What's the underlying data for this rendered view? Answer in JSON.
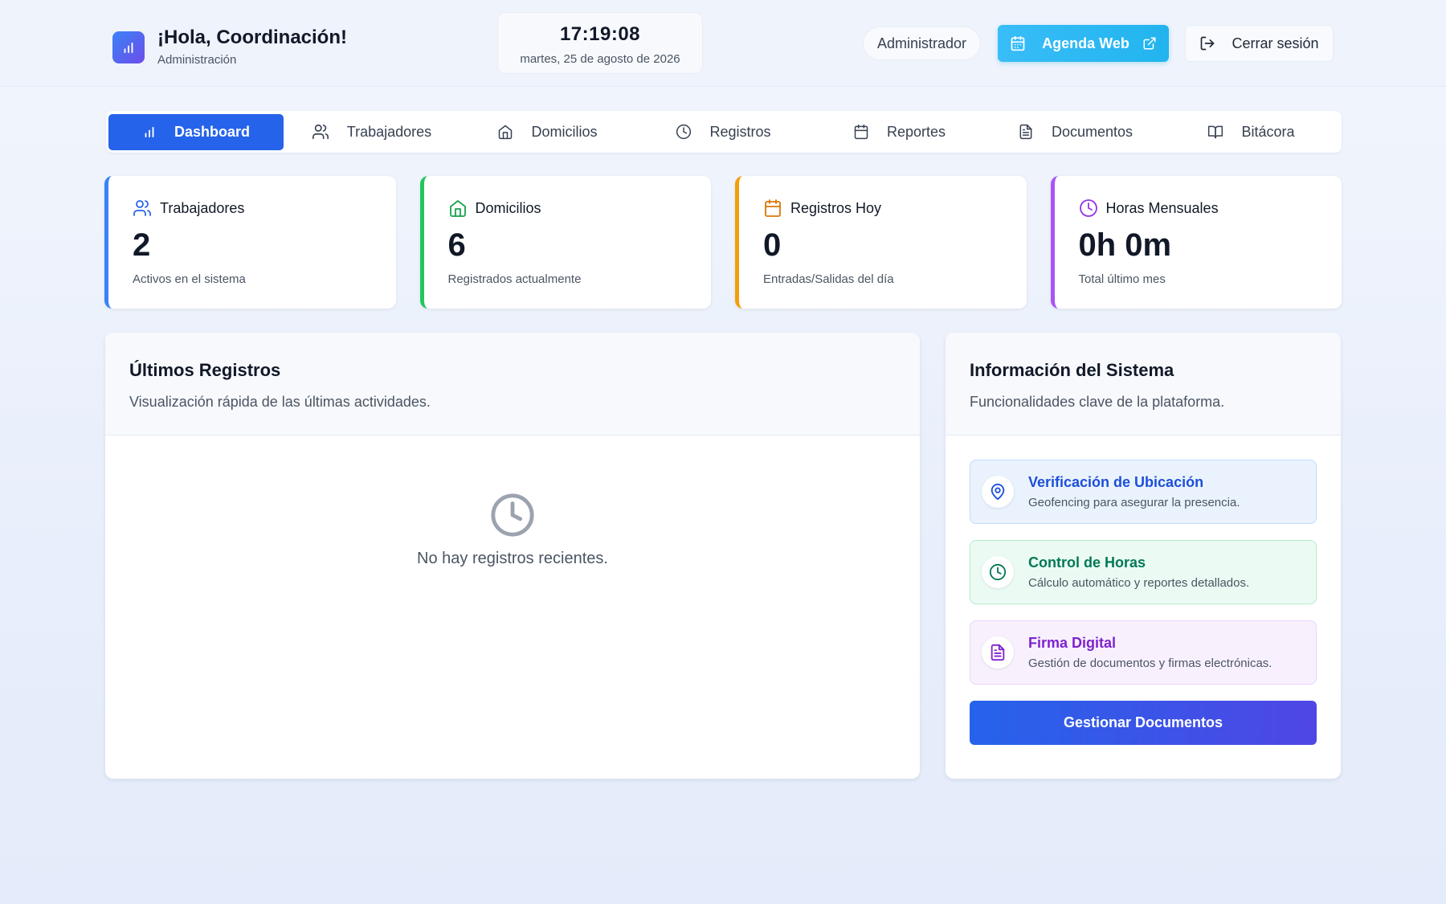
{
  "header": {
    "greeting": "¡Hola, Coordinación!",
    "role": "Administración",
    "clock_time": "17:19:08",
    "clock_date": "martes, 25 de agosto de 2026",
    "user_role_chip": "Administrador",
    "agenda_label": "Agenda Web",
    "logout_label": "Cerrar sesión",
    "icons": {
      "logo": "bar-chart-icon",
      "agenda": "calendar-icon",
      "agenda_external": "external-link-icon",
      "logout": "log-out-icon"
    }
  },
  "tabs": [
    {
      "label": "Dashboard",
      "icon": "bar-chart-icon",
      "active": true
    },
    {
      "label": "Trabajadores",
      "icon": "users-icon"
    },
    {
      "label": "Domicilios",
      "icon": "home-icon"
    },
    {
      "label": "Registros",
      "icon": "clock-icon"
    },
    {
      "label": "Reportes",
      "icon": "calendar-icon"
    },
    {
      "label": "Documentos",
      "icon": "file-text-icon"
    },
    {
      "label": "Bitácora",
      "icon": "book-open-icon"
    }
  ],
  "stats": [
    {
      "title": "Trabajadores",
      "value": "2",
      "subtitle": "Activos en el sistema",
      "color": "#3b82f6",
      "icon": "users-icon"
    },
    {
      "title": "Domicilios",
      "value": "6",
      "subtitle": "Registrados actualmente",
      "color": "#22c55e",
      "icon": "home-icon"
    },
    {
      "title": "Registros Hoy",
      "value": "0",
      "subtitle": "Entradas/Salidas del día",
      "color": "#f59e0b",
      "icon": "calendar-icon"
    },
    {
      "title": "Horas Mensuales",
      "value": "0h 0m",
      "subtitle": "Total último mes",
      "color": "#a855f7",
      "icon": "clock-icon"
    }
  ],
  "recent": {
    "title": "Últimos Registros",
    "description": "Visualización rápida de las últimas actividades.",
    "empty_text": "No hay registros recientes.",
    "empty_icon": "clock-icon"
  },
  "system": {
    "title": "Información del Sistema",
    "description": "Funcionalidades clave de la plataforma.",
    "features": [
      {
        "title": "Verificación de Ubicación",
        "description": "Geofencing para asegurar la presencia.",
        "icon": "map-pin-icon",
        "color": "#1d4ed8"
      },
      {
        "title": "Control de Horas",
        "description": "Cálculo automático y reportes detallados.",
        "icon": "clock-icon",
        "color": "#047857"
      },
      {
        "title": "Firma Digital",
        "description": "Gestión de documentos y firmas electrónicas.",
        "icon": "file-text-icon",
        "color": "#7e22ce"
      }
    ],
    "button_label": "Gestionar Documentos"
  }
}
